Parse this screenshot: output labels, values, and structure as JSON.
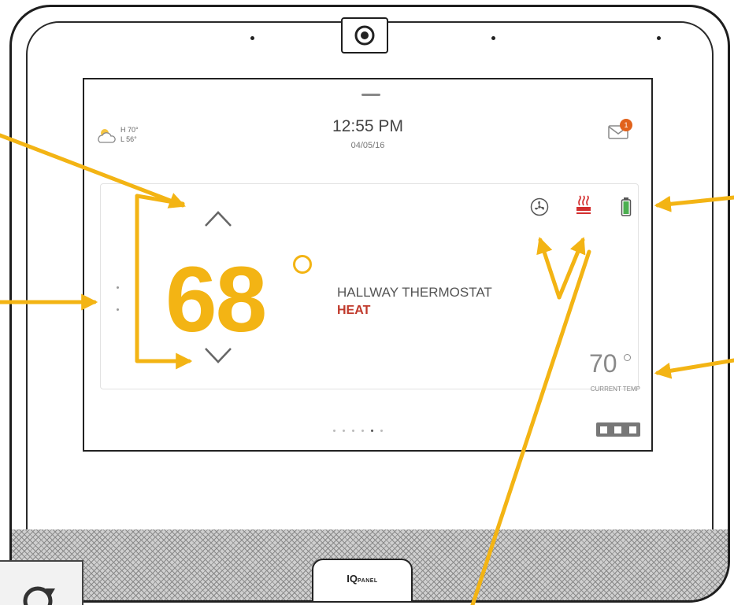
{
  "status_bar": {
    "weather": {
      "icon": "partly-cloudy-icon",
      "high": "H 70°",
      "low": "L 56°"
    },
    "time": "12:55 PM",
    "date": "04/05/16",
    "messages": {
      "icon": "envelope-icon",
      "count": "1"
    }
  },
  "thermostat": {
    "setpoint": "68",
    "name": "HALLWAY THERMOSTAT",
    "mode": "HEAT",
    "current_temp": "70",
    "current_temp_label": "CURRENT TEMP",
    "status_icons": [
      "fan-icon",
      "heat-icon",
      "battery-icon"
    ]
  },
  "pager": {
    "count": 6,
    "active_index": 4
  },
  "device": {
    "brand": "IQ",
    "brand_sub": "PANEL"
  },
  "colors": {
    "setpoint": "#f3b414",
    "mode": "#c0392b",
    "annotation_arrow": "#f3b414",
    "battery": "#4caf50",
    "heat": "#d32f2f"
  }
}
